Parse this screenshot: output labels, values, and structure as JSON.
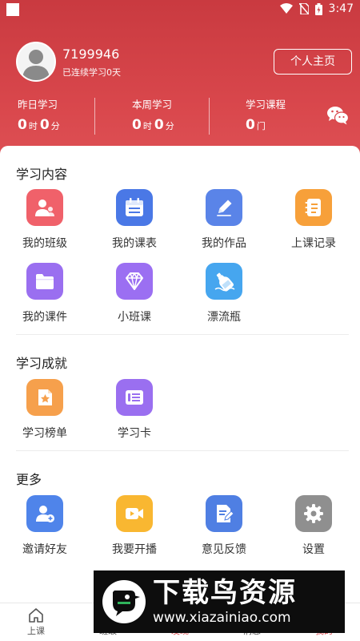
{
  "status_bar": {
    "time": "3:47"
  },
  "profile": {
    "user_id": "7199946",
    "streak_text": "已连续学习0天",
    "home_button": "个人主页"
  },
  "stats": [
    {
      "label": "昨日学习",
      "hours": "0",
      "hour_unit": "时",
      "minutes": "0",
      "minute_unit": "分"
    },
    {
      "label": "本周学习",
      "hours": "0",
      "hour_unit": "时",
      "minutes": "0",
      "minute_unit": "分"
    },
    {
      "label": "学习课程",
      "count": "0",
      "count_unit": "门"
    }
  ],
  "sections": {
    "content": {
      "title": "学习内容",
      "items": [
        {
          "label": "我的班级",
          "icon": "class-icon",
          "color": "#f0616a"
        },
        {
          "label": "我的课表",
          "icon": "calendar-icon",
          "color": "#4a78e6"
        },
        {
          "label": "我的作品",
          "icon": "pencil-icon",
          "color": "#5a84e8"
        },
        {
          "label": "上课记录",
          "icon": "notebook-icon",
          "color": "#f7a03a"
        },
        {
          "label": "我的课件",
          "icon": "folder-icon",
          "color": "#9a6ff0"
        },
        {
          "label": "小班课",
          "icon": "diamond-icon",
          "color": "#9b6ff2"
        },
        {
          "label": "漂流瓶",
          "icon": "bottle-icon",
          "color": "#46a6ef"
        }
      ]
    },
    "achievement": {
      "title": "学习成就",
      "items": [
        {
          "label": "学习榜单",
          "icon": "ranking-icon",
          "color": "#f6a04c"
        },
        {
          "label": "学习卡",
          "icon": "card-icon",
          "color": "#9a6ff0"
        }
      ]
    },
    "more": {
      "title": "更多",
      "items": [
        {
          "label": "邀请好友",
          "icon": "invite-friend-icon",
          "color": "#4f84ea"
        },
        {
          "label": "我要开播",
          "icon": "video-icon",
          "color": "#f9b731"
        },
        {
          "label": "意见反馈",
          "icon": "feedback-icon",
          "color": "#4f7fe3"
        },
        {
          "label": "设置",
          "icon": "gear-icon",
          "color": "#8f8f8f"
        }
      ]
    }
  },
  "tabbar": {
    "items": [
      {
        "label": "上课"
      },
      {
        "label": "班级"
      },
      {
        "label": "发现"
      },
      {
        "label": "消息"
      },
      {
        "label": "我的"
      }
    ]
  },
  "watermark": {
    "title": "下载鸟资源",
    "url": "www.xiazainiao.com"
  }
}
